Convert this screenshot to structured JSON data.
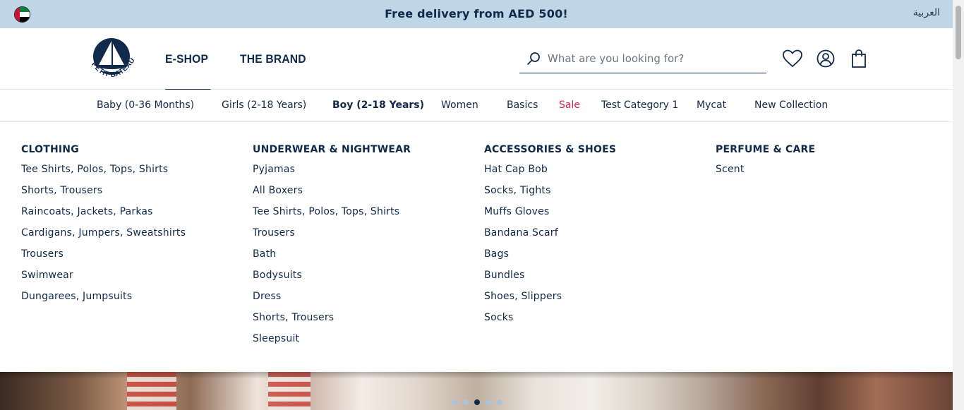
{
  "promo": {
    "message": "Free delivery from AED 500!",
    "language_link": "العربية",
    "flag_icon": "uae-flag-icon"
  },
  "header": {
    "logo_text": "PETIT BATEAU",
    "top_nav": [
      "E-SHOP",
      "THE BRAND"
    ],
    "active_top_nav": "E-SHOP",
    "search_placeholder": "What are you looking for?",
    "icons": [
      "search-icon",
      "heart-icon",
      "account-icon",
      "bag-icon"
    ]
  },
  "categories": [
    {
      "label": "Baby (0-36 Months)",
      "state": "normal"
    },
    {
      "label": "Girls (2-18 Years)",
      "state": "normal"
    },
    {
      "label": "Boy (2-18 Years)",
      "state": "active"
    },
    {
      "label": "Women",
      "state": "normal"
    },
    {
      "label": "Basics",
      "state": "normal"
    },
    {
      "label": "Sale",
      "state": "sale"
    },
    {
      "label": "Test Category 1",
      "state": "normal"
    },
    {
      "label": "Mycat",
      "state": "normal"
    },
    {
      "label": "New Collection",
      "state": "normal"
    }
  ],
  "mega_menu": {
    "columns": [
      {
        "title": "CLOTHING",
        "items": [
          "Tee Shirts, Polos, Tops, Shirts",
          "Shorts, Trousers",
          "Raincoats, Jackets, Parkas",
          "Cardigans, Jumpers, Sweatshirts",
          "Trousers",
          "Swimwear",
          "Dungarees, Jumpsuits"
        ]
      },
      {
        "title": "UNDERWEAR & NIGHTWEAR",
        "items": [
          "Pyjamas",
          "All Boxers",
          "Tee Shirts, Polos, Tops, Shirts",
          "Trousers",
          "Bath",
          "Bodysuits",
          "Dress",
          "Shorts, Trousers",
          "Sleepsuit"
        ]
      },
      {
        "title": "ACCESSORIES & SHOES",
        "items": [
          "Hat Cap Bob",
          "Socks, Tights",
          "Muffs Gloves",
          "Bandana Scarf",
          "Bags",
          "Bundles",
          "Shoes, Slippers",
          "Socks"
        ]
      },
      {
        "title": "PERFUME & CARE",
        "items": [
          "Scent"
        ]
      }
    ]
  },
  "carousel": {
    "slide_count": 5,
    "active_index": 2
  },
  "colors": {
    "navy": "#0f2a4a",
    "promo_bg": "#bfd6e6",
    "sale": "#d6204a"
  }
}
